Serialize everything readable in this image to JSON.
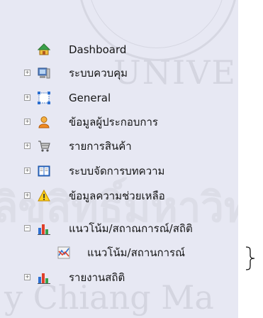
{
  "watermark": {
    "line1": "UNIVER",
    "line2": "ลิขสิทธิ์มหาวิทยาลัย",
    "line3": "y Chiang Ma"
  },
  "tree": {
    "items": [
      {
        "label": "Dashboard",
        "icon": "home-icon",
        "expandable": false
      },
      {
        "label": "ระบบควบคุม",
        "icon": "computer-icon",
        "expandable": true
      },
      {
        "label": "General",
        "icon": "general-settings-icon",
        "expandable": true
      },
      {
        "label": "ข้อมูลผู้ประกอบการ",
        "icon": "user-icon",
        "expandable": true
      },
      {
        "label": "รายการสินค้า",
        "icon": "shopping-cart-icon",
        "expandable": true
      },
      {
        "label": "ระบบจัดการบทความ",
        "icon": "book-icon",
        "expandable": true
      },
      {
        "label": "ข้อมูลความช่วยเหลือ",
        "icon": "warning-icon",
        "expandable": true
      },
      {
        "label": "แนวโน้ม/สถาณการณ์/สถิติ",
        "icon": "bar-chart-icon",
        "expandable": true,
        "expanded": true,
        "children": [
          {
            "label": "แนวโน้ม/สถานการณ์",
            "icon": "trend-chart-icon"
          }
        ]
      },
      {
        "label": "รายงานสถิติ",
        "icon": "bar-chart-icon",
        "expandable": true
      }
    ]
  },
  "colors": {
    "panel_bg": "#e7e8f3",
    "text": "#151515",
    "expander_border": "#9b9b9b"
  }
}
